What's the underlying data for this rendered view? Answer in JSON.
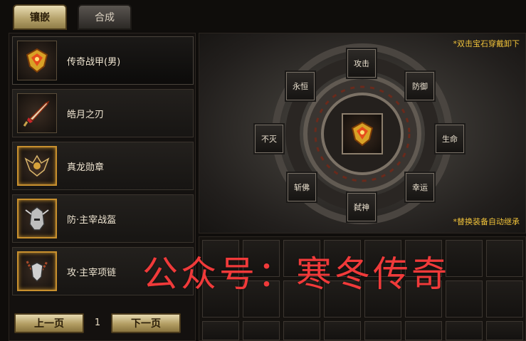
{
  "tabs": {
    "inlay": "镶嵌",
    "merge": "合成"
  },
  "items": [
    {
      "name": "传奇战甲(男)",
      "icon": "armor-icon"
    },
    {
      "name": "皓月之刃",
      "icon": "sword-icon"
    },
    {
      "name": "真龙勋章",
      "icon": "medal-icon"
    },
    {
      "name": "防·主宰战盔",
      "icon": "helmet-icon"
    },
    {
      "name": "攻·主宰项链",
      "icon": "necklace-icon"
    }
  ],
  "pager": {
    "prev": "上一页",
    "page": "1",
    "next": "下一页"
  },
  "wheel": {
    "hint_top": "*双击宝石穿戴卸下",
    "hint_bottom": "*替换装备自动继承",
    "slots": {
      "attack": "攻击",
      "defense": "防御",
      "life": "生命",
      "luck": "幸运",
      "slay": "弑神",
      "buddha": "斩佛",
      "immortal": "不灭",
      "eternal": "永恒"
    }
  },
  "watermark": "公众号：寒冬传奇",
  "colors": {
    "accent_gold": "#f0c23a",
    "watermark_red": "#f03a3a"
  }
}
